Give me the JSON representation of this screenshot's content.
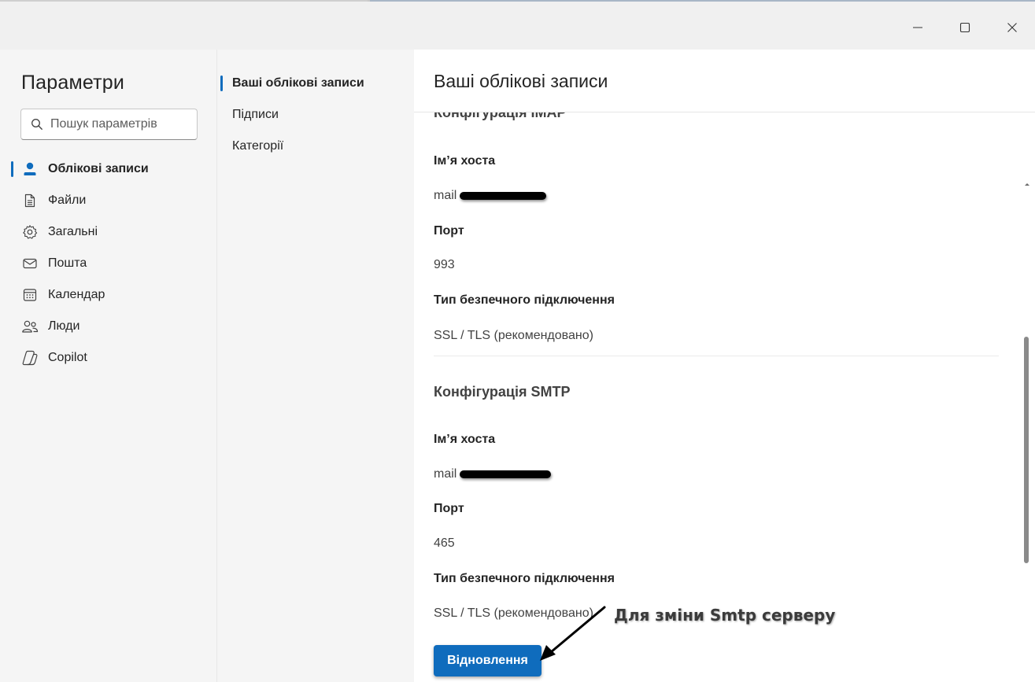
{
  "window": {
    "minimize_icon": "minimize-icon",
    "maximize_icon": "maximize-icon",
    "close_icon": "close-icon"
  },
  "nav": {
    "title": "Параметри",
    "search_placeholder": "Пошук параметрів",
    "items": [
      {
        "label": "Облікові записи",
        "icon": "person-icon",
        "active": true
      },
      {
        "label": "Файли",
        "icon": "file-icon",
        "active": false
      },
      {
        "label": "Загальні",
        "icon": "gear-icon",
        "active": false
      },
      {
        "label": "Пошта",
        "icon": "mail-icon",
        "active": false
      },
      {
        "label": "Календар",
        "icon": "calendar-icon",
        "active": false
      },
      {
        "label": "Люди",
        "icon": "people-icon",
        "active": false
      },
      {
        "label": "Copilot",
        "icon": "copilot-icon",
        "active": false
      }
    ]
  },
  "subnav": {
    "items": [
      {
        "label": "Ваші облікові записи",
        "active": true
      },
      {
        "label": "Підписи",
        "active": false
      },
      {
        "label": "Категорії",
        "active": false
      }
    ]
  },
  "content": {
    "title": "Ваші облікові записи",
    "imap": {
      "section_title": "Конфігурація IMAP",
      "host_label": "Ім’я хоста",
      "host_value": "mail",
      "port_label": "Порт",
      "port_value": "993",
      "security_label": "Тип безпечного підключення",
      "security_value": "SSL / TLS (рекомендовано)"
    },
    "smtp": {
      "section_title": "Конфігурація SMTP",
      "host_label": "Ім’я хоста",
      "host_value": "mail",
      "port_label": "Порт",
      "port_value": "465",
      "security_label": "Тип безпечного підключення",
      "security_value": "SSL / TLS (рекомендовано)"
    },
    "restore_button": "Відновлення"
  },
  "annotation": {
    "text": "Для зміни Smtp серверу"
  },
  "colors": {
    "accent": "#0f6cbd",
    "pane_bg": "#f5f5f5",
    "content_bg": "#ffffff"
  }
}
